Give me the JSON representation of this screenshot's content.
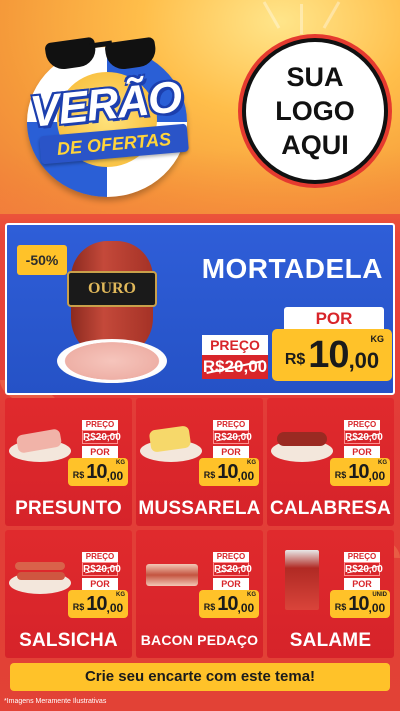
{
  "header": {
    "campaign_title": "VERÃO",
    "campaign_subtitle": "DE OFERTAS",
    "logo_placeholder": [
      "SUA",
      "LOGO",
      "AQUI"
    ]
  },
  "featured": {
    "discount": "-50%",
    "brand_label": "OURO",
    "product_name": "MORTADELA",
    "preco_label": "PREÇO",
    "old_price": "R$20,00",
    "por_label": "POR",
    "currency": "R$",
    "price_int": "10",
    "price_dec": ",00",
    "unit": "KG"
  },
  "products": [
    {
      "name": "PRESUNTO",
      "preco_label": "PREÇO",
      "old_price": "R$20,00",
      "por_label": "POR",
      "currency": "R$",
      "price_int": "10",
      "price_dec": ",00",
      "unit": "KG"
    },
    {
      "name": "MUSSARELA",
      "preco_label": "PREÇO",
      "old_price": "R$20,00",
      "por_label": "POR",
      "currency": "R$",
      "price_int": "10",
      "price_dec": ",00",
      "unit": "KG"
    },
    {
      "name": "CALABRESA",
      "preco_label": "PREÇO",
      "old_price": "R$20,00",
      "por_label": "POR",
      "currency": "R$",
      "price_int": "10",
      "price_dec": ",00",
      "unit": "KG"
    },
    {
      "name": "SALSICHA",
      "preco_label": "PREÇO",
      "old_price": "R$20,00",
      "por_label": "POR",
      "currency": "R$",
      "price_int": "10",
      "price_dec": ",00",
      "unit": "KG"
    },
    {
      "name": "BACON PEDAÇO",
      "preco_label": "PREÇO",
      "old_price": "R$20,00",
      "por_label": "POR",
      "currency": "R$",
      "price_int": "10",
      "price_dec": ",00",
      "unit": "KG"
    },
    {
      "name": "SALAME",
      "preco_label": "PREÇO",
      "old_price": "R$20,00",
      "por_label": "POR",
      "currency": "R$",
      "price_int": "10",
      "price_dec": ",00",
      "unit": "UNID"
    }
  ],
  "cta": "Crie seu encarte com este tema!",
  "disclaimer": "*Imagens Meramente Ilustrativas",
  "colors": {
    "red": "#d8252a",
    "blue": "#2552c6",
    "yellow": "#ffc229"
  }
}
